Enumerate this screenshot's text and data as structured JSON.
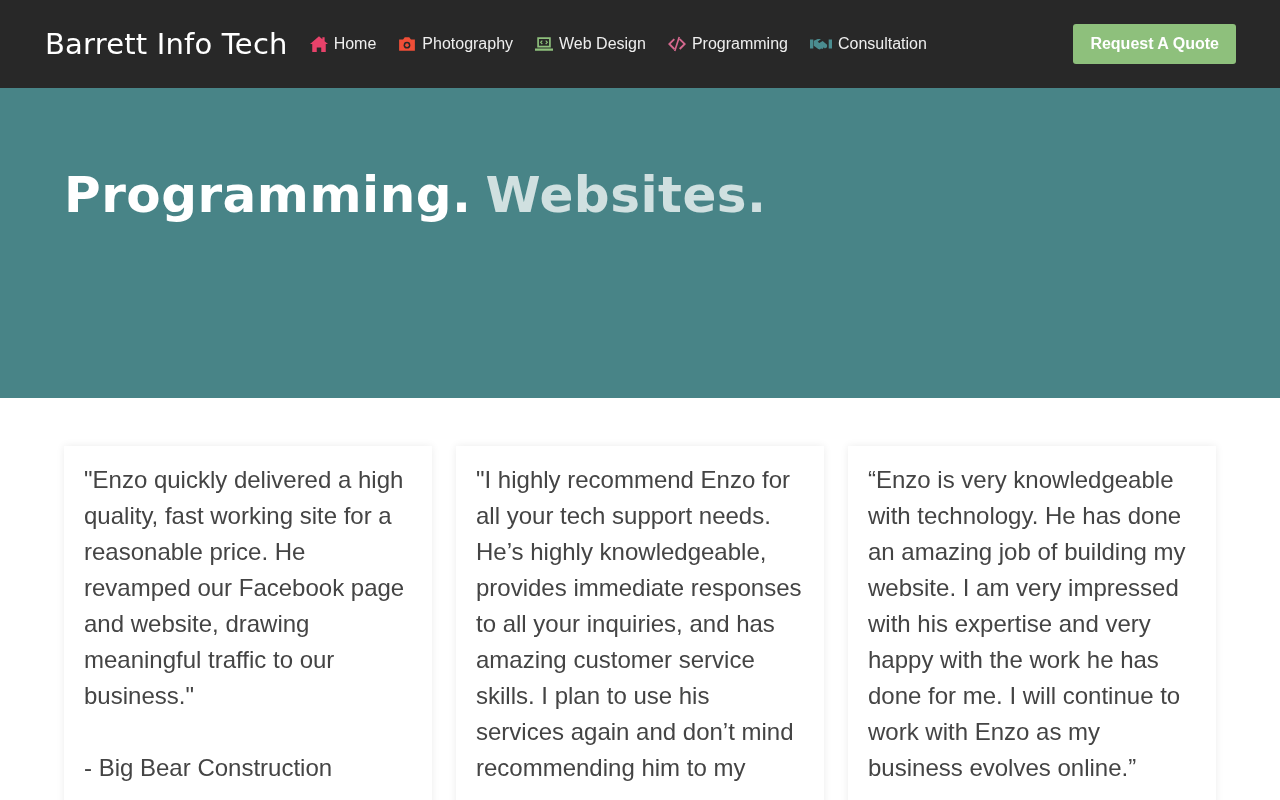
{
  "header": {
    "logo": "Barrett Info Tech",
    "nav": [
      {
        "label": "Home",
        "kind": "house",
        "color": "#e8426a"
      },
      {
        "label": "Photography",
        "kind": "camera",
        "color": "#f04e37"
      },
      {
        "label": "Web Design",
        "kind": "laptop",
        "color": "#8ec07c"
      },
      {
        "label": "Programming",
        "kind": "code",
        "color": "#d4688e"
      },
      {
        "label": "Consultation",
        "kind": "handshake",
        "color": "#4a8c8f"
      }
    ],
    "cta": "Request A Quote"
  },
  "hero": {
    "heading": [
      "Programming.",
      "Websites."
    ]
  },
  "testimonials": [
    {
      "quote": "\"Enzo quickly delivered a high quality, fast working site for a reasonable price. He revamped our Facebook page and website, drawing meaningful traffic to our business.\"",
      "author": "- Big Bear Construction"
    },
    {
      "quote": "\"I highly recommend Enzo for all your tech support needs. He’s highly knowledgeable, provides immediate responses to all your inquiries, and has amazing customer service skills. I plan to use his services again and don’t mind recommending him to my"
    },
    {
      "quote": "“Enzo is very knowledgeable with technology. He has done an amazing job of building my website. I am very impressed with his expertise and very happy with the work he has done for me. I will continue to work with Enzo as my business evolves online.”"
    }
  ]
}
